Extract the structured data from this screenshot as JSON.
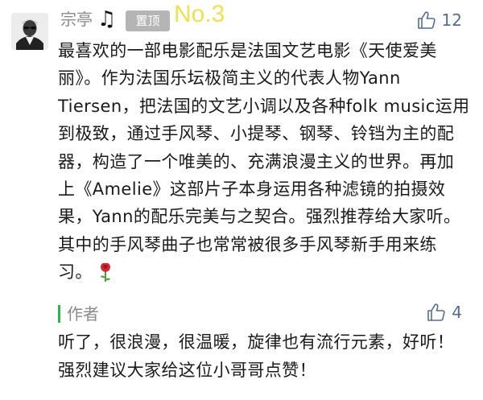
{
  "comment": {
    "author": "宗亭",
    "author_emoji_icon": "music-note-icon",
    "author_emoji": "♫",
    "pin_label": "置顶",
    "rank_label": "No.3",
    "likes": "12",
    "text": "最喜欢的一部电影配乐是法国文艺电影《天使爱美丽》。作为法国乐坛极简主义的代表人物Yann Tiersen，把法国的文艺小调以及各种folk music运用到极致，通过手风琴、小提琴、钢琴、铃铛为主的配器，构造了一个唯美的、充满浪漫主义的世界。再加上《Amelie》这部片子本身运用各种滤镜的拍摄效果，Yann的配乐完美与之契合。强烈推荐给大家听。其中的手风琴曲子也常常被很多手风琴新手用来练习。",
    "trailing_icon": "rose-icon"
  },
  "reply": {
    "label": "作者",
    "likes": "4",
    "text": "听了，很浪漫，很温暖，旋律也有流行元素，好听！强烈建议大家给这位小哥哥点赞！"
  },
  "colors": {
    "accent_link": "#576b95",
    "author_gray": "#8a8a8a",
    "pin_badge_bg": "#b5b5b5",
    "rank_yellow": "#f4e04d",
    "reply_bar_green": "#2eb34f"
  }
}
